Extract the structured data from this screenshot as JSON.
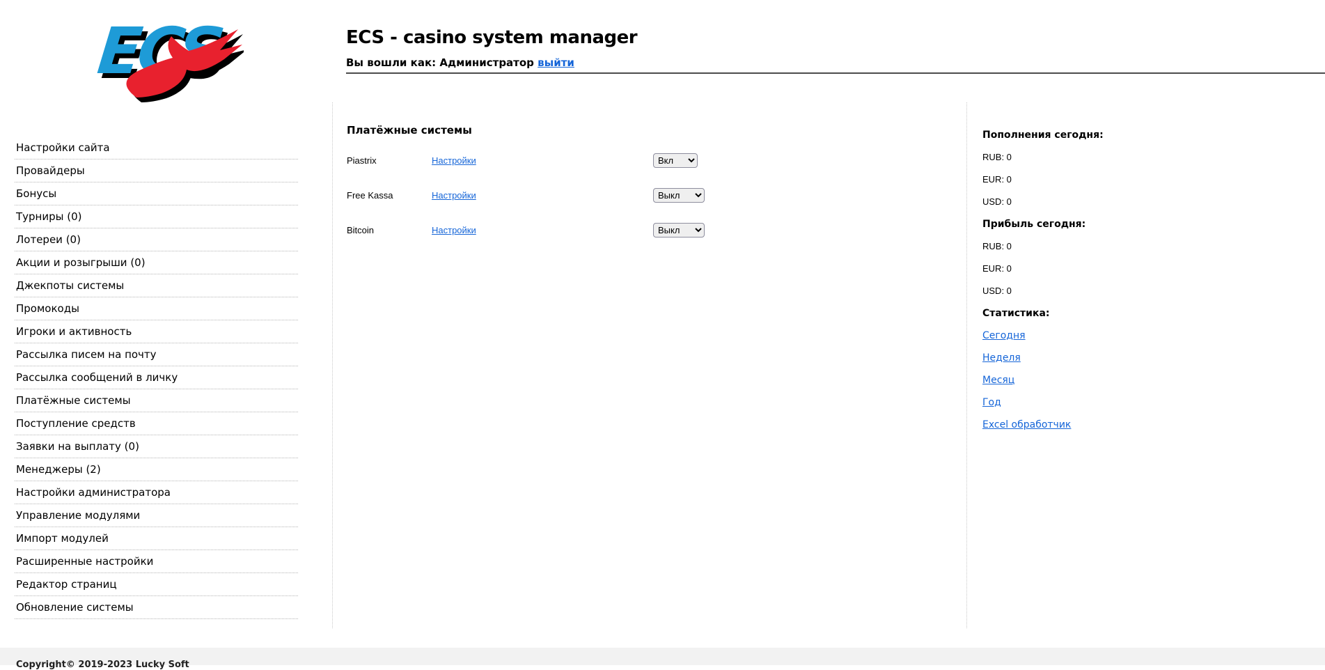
{
  "header": {
    "logo_text": "ECS",
    "title": "ECS - casino system manager",
    "login_label": "Вы вошли как: Администратор",
    "logout_link": "выйти"
  },
  "sidebar": {
    "items": [
      "Настройки сайта",
      "Провайдеры",
      "Бонусы",
      "Турниры (0)",
      "Лотереи (0)",
      "Акции и розыгрыши (0)",
      "Джекпоты системы",
      "Промокоды",
      "Игроки и активность",
      "Рассылка писем на почту",
      "Рассылка сообщений в личку",
      "Платёжные системы",
      "Поступление средств",
      "Заявки на выплату (0)",
      "Менеджеры (2)",
      "Настройки администратора",
      "Управление модулями",
      "Импорт модулей",
      "Расширенные настройки",
      "Редактор страниц",
      "Обновление системы"
    ]
  },
  "main": {
    "title": "Платёжные системы",
    "select_options": [
      "Вкл",
      "Выкл"
    ],
    "rows": [
      {
        "name": "Piastrix",
        "settings_label": "Настройки",
        "state": "Вкл"
      },
      {
        "name": "Free Kassa",
        "settings_label": "Настройки",
        "state": "Выкл"
      },
      {
        "name": "Bitcoin",
        "settings_label": "Настройки",
        "state": "Выкл"
      }
    ]
  },
  "stats_panel": {
    "deposits_title": "Пополнения сегодня:",
    "deposits": [
      "RUB: 0",
      "EUR: 0",
      "USD: 0"
    ],
    "profit_title": "Прибыль сегодня:",
    "profit": [
      "RUB: 0",
      "EUR: 0",
      "USD: 0"
    ],
    "stats_title": "Статистика:",
    "links": [
      "Сегодня",
      "Неделя",
      "Месяц",
      "Год",
      "Excel обработчик"
    ]
  },
  "footer": {
    "copyright": "Copyright© 2019-2023 Lucky Soft"
  },
  "colors": {
    "link_blue": "#1565d8",
    "logo_blue": "#1E9BD7",
    "logo_red": "#E8212E",
    "footer_bg": "#f2f2f2",
    "rule_gray": "#4c4c4c"
  }
}
